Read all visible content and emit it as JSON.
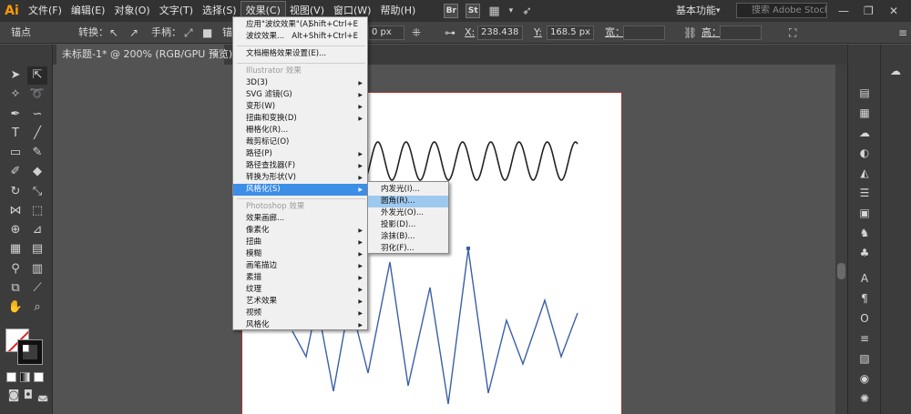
{
  "menubar": {
    "logo": "Ai",
    "items": [
      "文件(F)",
      "编辑(E)",
      "对象(O)",
      "文字(T)",
      "选择(S)",
      "效果(C)",
      "视图(V)",
      "窗口(W)",
      "帮助(H)"
    ],
    "br_label": "Br",
    "st_label": "St",
    "workspace": "基本功能",
    "search_placeholder": "搜索 Adobe Stock"
  },
  "controlbar": {
    "anchor_label": "锚点",
    "convert_label": "转换：",
    "handle_label": "手柄：",
    "cut_label": "锚",
    "px_field": "0 px",
    "x_label": "X:",
    "x_value": "238.438 1",
    "y_label": "Y:",
    "y_value": "168.5 px",
    "w_label": "宽：",
    "h_label": "高："
  },
  "tab": {
    "title": "未标题-1* @ 200% (RGB/GPU 预览)",
    "close": "×"
  },
  "effect_menu": {
    "apply_last": "应用\"波纹效果\"(A)",
    "apply_last_shortcut": "Shift+Ctrl+E",
    "last_effect": "波纹效果...",
    "last_effect_shortcut": "Alt+Shift+Ctrl+E",
    "doc_raster": "文档栅格效果设置(E)...",
    "illustrator_header": "Illustrator 效果",
    "illustrator_items": [
      "3D(3)",
      "SVG 滤镜(G)",
      "变形(W)",
      "扭曲和变换(D)",
      "栅格化(R)...",
      "裁剪标记(O)",
      "路径(P)",
      "路径查找器(F)",
      "转换为形状(V)",
      "风格化(S)"
    ],
    "photoshop_header": "Photoshop 效果",
    "photoshop_items": [
      "效果画廊...",
      "像素化",
      "扭曲",
      "模糊",
      "画笔描边",
      "素描",
      "纹理",
      "艺术效果",
      "视频",
      "风格化"
    ]
  },
  "stylize_submenu": {
    "items": [
      "内发光(I)...",
      "圆角(R)...",
      "外发光(O)...",
      "投影(D)...",
      "涂抹(B)...",
      "羽化(F)..."
    ]
  },
  "icons": {
    "search": "search-icon",
    "arrow": "chevron-down-icon"
  },
  "colors": {
    "highlight": "#3d8ee6",
    "hover": "#9ec9ef",
    "zigzag": "#3b5fa8"
  }
}
